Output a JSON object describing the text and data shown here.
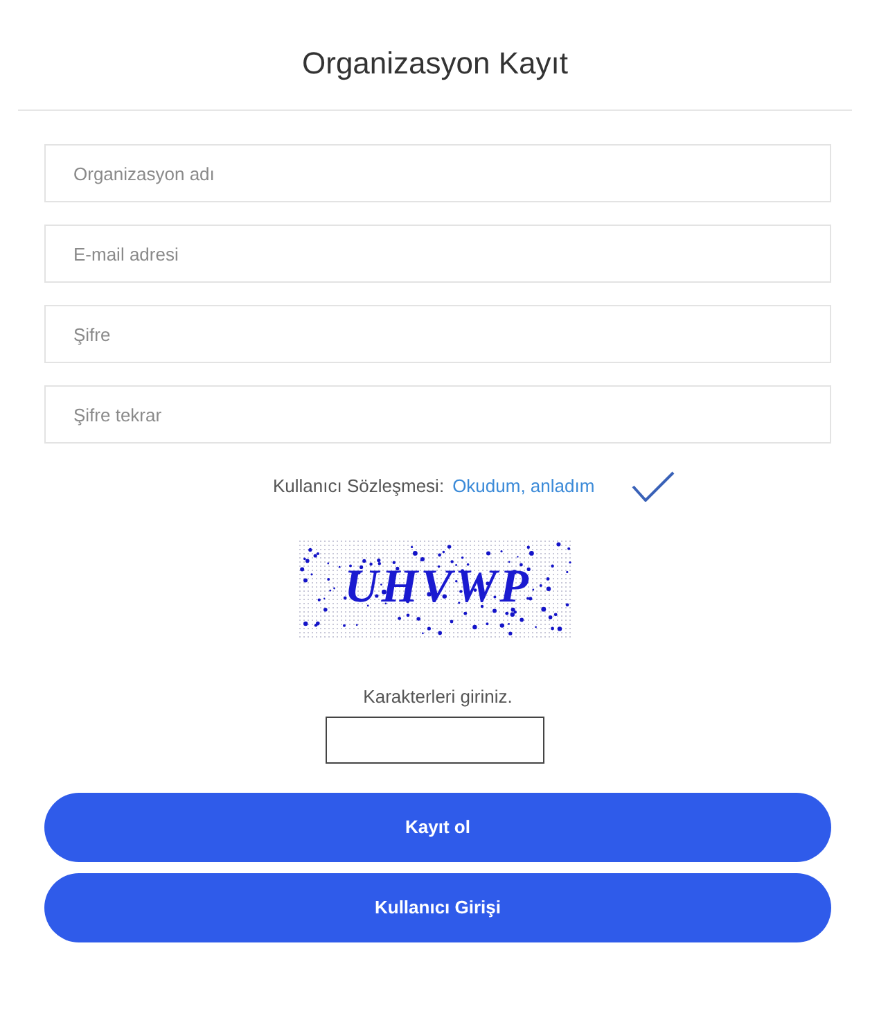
{
  "title": "Organizasyon Kayıt",
  "fields": [
    {
      "placeholder": "Organizasyon adı"
    },
    {
      "placeholder": "E-mail adresi"
    },
    {
      "placeholder": "Şifre"
    },
    {
      "placeholder": "Şifre tekrar"
    }
  ],
  "agreement": {
    "label": "Kullanıcı Sözleşmesi:",
    "link": "Okudum, anladım",
    "checked": true
  },
  "captcha": {
    "text": "UHVWP",
    "prompt": "Karakterleri giriniz."
  },
  "buttons": [
    {
      "label": "Kayıt ol"
    },
    {
      "label": "Kullanıcı Girişi"
    }
  ]
}
